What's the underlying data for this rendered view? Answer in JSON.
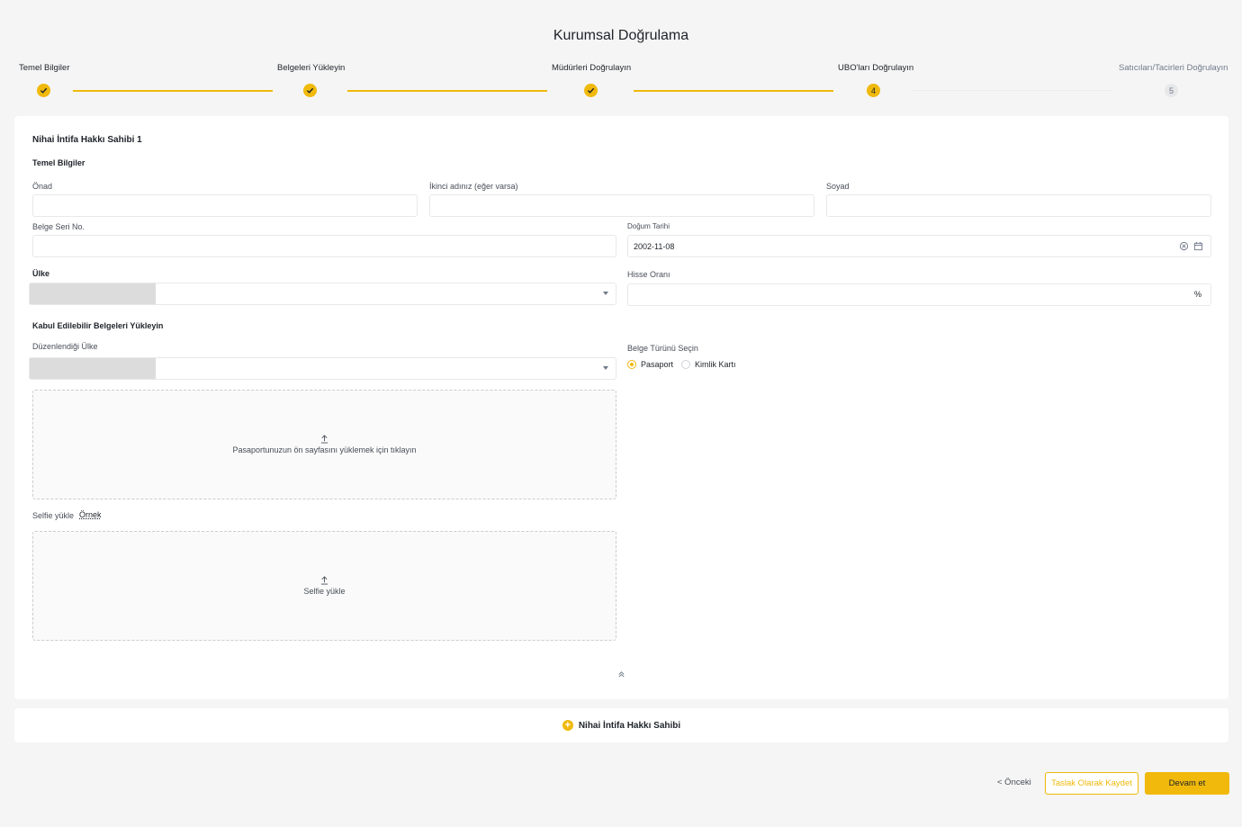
{
  "page": {
    "title": "Kurumsal Doğrulama"
  },
  "stepper": {
    "steps": [
      {
        "label": "Temel Bilgiler",
        "status": "done",
        "badge": ""
      },
      {
        "label": "Belgeleri Yükleyin",
        "status": "done",
        "badge": ""
      },
      {
        "label": "Müdürleri Doğrulayın",
        "status": "done",
        "badge": ""
      },
      {
        "label": "UBO'ları Doğrulayın",
        "status": "current",
        "badge": "4"
      },
      {
        "label": "Satıcıları/Tacirleri Doğrulayın",
        "status": "pending",
        "badge": "5"
      }
    ]
  },
  "form": {
    "heading": "Nihai İntifa Hakkı Sahibi 1",
    "basic_section": "Temel Bilgiler",
    "first_name": {
      "label": "Önad",
      "value": ""
    },
    "middle_name": {
      "label": "İkinci adınız (eğer varsa)",
      "value": ""
    },
    "last_name": {
      "label": "Soyad",
      "value": ""
    },
    "document_serial": {
      "label": "Belge Seri No.",
      "value": ""
    },
    "birth_date": {
      "label": "Doğum Tarihi",
      "value": "2002-11-08"
    },
    "country": {
      "label": "Ülke",
      "value": ""
    },
    "share_ratio": {
      "label": "Hisse Oranı",
      "value": "",
      "suffix": "%"
    },
    "documents_section": "Kabul Edilebilir Belgeleri Yükleyin",
    "issuing_country": {
      "label": "Düzenlendiği Ülke",
      "value": ""
    },
    "document_type": {
      "label": "Belge Türünü Seçin",
      "options": [
        "Pasaport",
        "Kimlik Kartı"
      ],
      "selected": "Pasaport"
    },
    "passport_upload": {
      "text": "Pasaportunuzun ön sayfasını yüklemek için tıklayın"
    },
    "selfie": {
      "label": "Selfie yükle",
      "example_link": "Örnek",
      "upload_text": "Selfie yükle"
    }
  },
  "add_owner": {
    "label": "Nihai İntifa Hakkı Sahibi"
  },
  "footer": {
    "prev_label": "< Önceki",
    "draft_label": "Taslak Olarak Kaydet",
    "next_label": "Devam et"
  },
  "colors": {
    "accent": "#f0b90b",
    "background": "#f5f5f5",
    "card": "#ffffff",
    "text": "#1e2329"
  }
}
